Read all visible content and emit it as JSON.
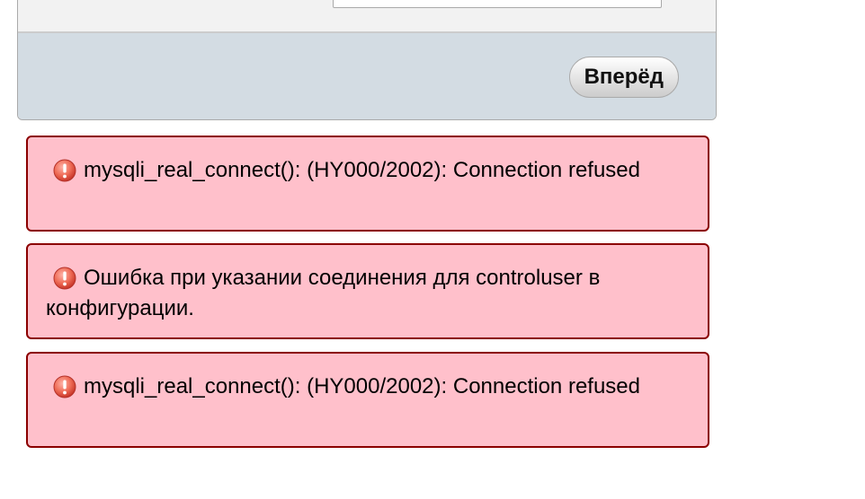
{
  "login_panel": {
    "go_button_label": "Вперёд"
  },
  "errors": [
    {
      "icon": "error-icon",
      "message": "mysqli_real_connect(): (HY000/2002): Connection refused"
    },
    {
      "icon": "error-icon",
      "message": "Ошибка при указании соединения для controluser в конфигурации."
    },
    {
      "icon": "error-icon",
      "message": "mysqli_real_connect(): (HY000/2002): Connection refused"
    }
  ],
  "colors": {
    "error_background": "#ffc0cb",
    "error_border": "#8b0000",
    "footer_background": "#d3dce3"
  }
}
